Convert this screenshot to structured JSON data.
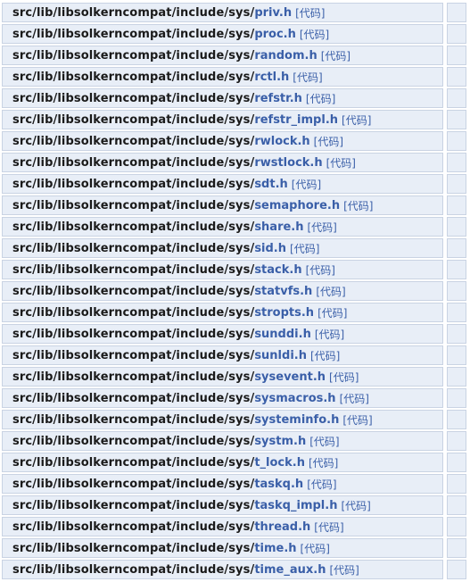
{
  "path_prefix": "src/lib/libsolkerncompat/include/sys/",
  "code_label": "[代码]",
  "colors": {
    "row_bg": "#e8eef7",
    "row_border": "#c9d3e3",
    "link": "#3a5fa8",
    "text": "#1a1a1a"
  },
  "files": [
    "priv.h",
    "proc.h",
    "random.h",
    "rctl.h",
    "refstr.h",
    "refstr_impl.h",
    "rwlock.h",
    "rwstlock.h",
    "sdt.h",
    "semaphore.h",
    "share.h",
    "sid.h",
    "stack.h",
    "statvfs.h",
    "stropts.h",
    "sunddi.h",
    "sunldi.h",
    "sysevent.h",
    "sysmacros.h",
    "systeminfo.h",
    "systm.h",
    "t_lock.h",
    "taskq.h",
    "taskq_impl.h",
    "thread.h",
    "time.h",
    "time_aux.h"
  ]
}
